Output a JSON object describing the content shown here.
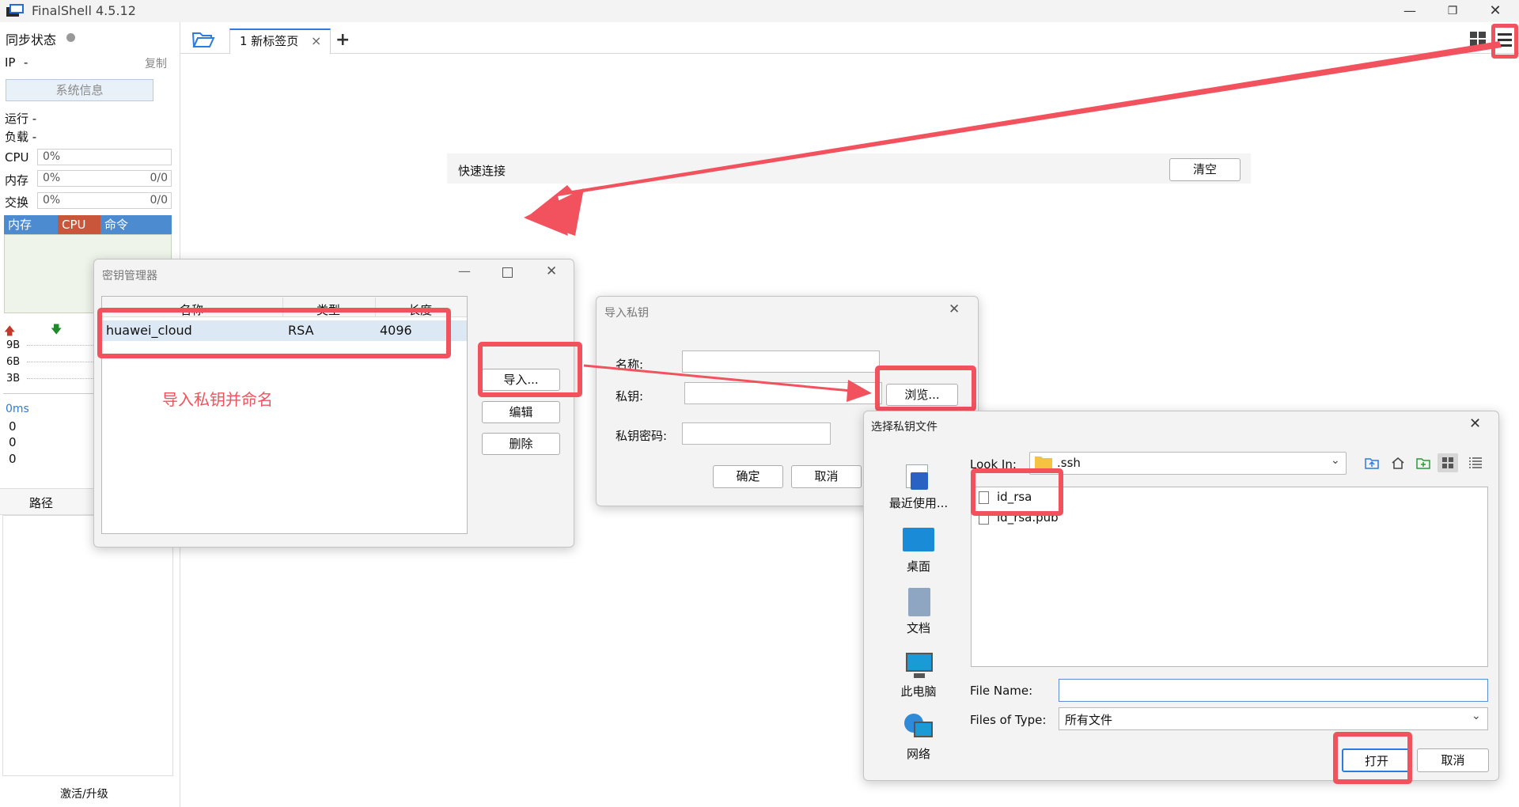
{
  "app": {
    "title": "FinalShell 4.5.12"
  },
  "sidebar": {
    "sync_label": "同步状态",
    "ip_label": "IP",
    "ip_value": "-",
    "copy_label": "复制",
    "sysinfo_button": "系统信息",
    "run_label": "运行 -",
    "load_label": "负载 -",
    "cpu_label": "CPU",
    "cpu_value": "0%",
    "mem_label": "内存",
    "mem_value": "0%",
    "mem_ratio": "0/0",
    "swap_label": "交换",
    "swap_value": "0%",
    "swap_ratio": "0/0",
    "proc_headers": [
      "内存",
      "CPU",
      "命令"
    ],
    "net_scale": [
      "9B",
      "6B",
      "3B"
    ],
    "latency": "0ms",
    "latency_values": [
      "0",
      "0",
      "0"
    ],
    "path_header": "路径",
    "activate_label": "激活/升级"
  },
  "tabs": {
    "tab1_label": "1 新标签页",
    "close_glyph": "×",
    "add_glyph": "+"
  },
  "quick_connect": {
    "label": "快速连接",
    "clear_button": "清空"
  },
  "key_manager": {
    "title": "密钥管理器",
    "columns": [
      "名称",
      "类型",
      "长度"
    ],
    "rows": [
      {
        "name": "huawei_cloud",
        "type": "RSA",
        "length": "4096"
      }
    ],
    "import_button": "导入...",
    "edit_button": "编辑",
    "delete_button": "删除",
    "annotation": "导入私钥并命名"
  },
  "import_key": {
    "title": "导入私钥",
    "name_label": "名称:",
    "key_label": "私钥:",
    "password_label": "私钥密码:",
    "browse_button": "浏览...",
    "ok_button": "确定",
    "cancel_button": "取消"
  },
  "file_chooser": {
    "title": "选择私钥文件",
    "look_in_label": "Look In:",
    "look_in_value": ".ssh",
    "places": [
      "最近使用...",
      "桌面",
      "文档",
      "此电脑",
      "网络"
    ],
    "files": [
      "id_rsa",
      "id_rsa.pub"
    ],
    "file_name_label": "File Name:",
    "file_name_value": "",
    "file_type_label": "Files of Type:",
    "file_type_value": "所有文件",
    "open_button": "打开",
    "cancel_button": "取消"
  },
  "colors": {
    "accent": "#2d7be0",
    "annotation": "#f2525e",
    "proc_header": "#4d8bd1",
    "proc_cpu": "#c9553b"
  }
}
